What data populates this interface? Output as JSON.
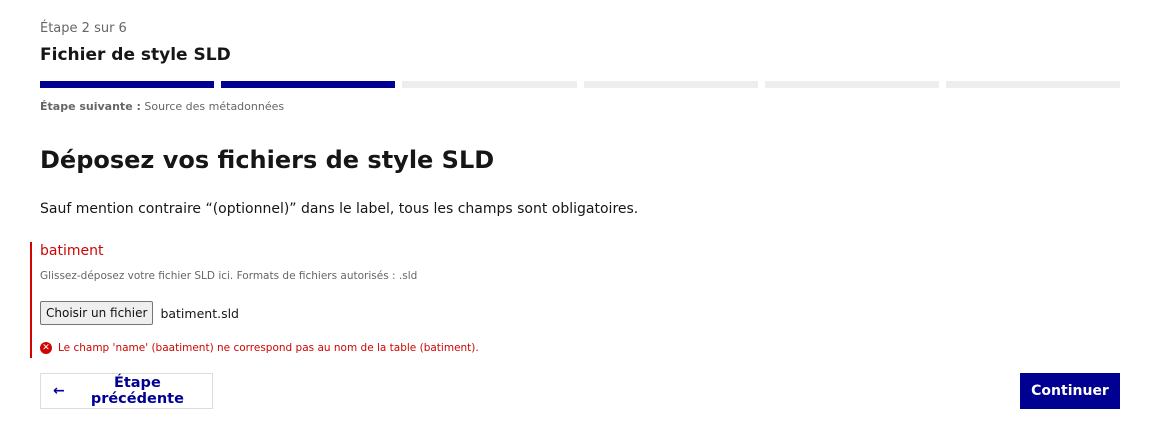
{
  "stepper": {
    "state": "Étape 2 sur 6",
    "title": "Fichier de style SLD",
    "steps_total": 6,
    "steps_done": 2,
    "next_label": "Étape suivante :",
    "next_value": "Source des métadonnées"
  },
  "main": {
    "title": "Déposez vos fichiers de style SLD",
    "intro": "Sauf mention contraire “(optionnel)” dans le label, tous les champs sont obligatoires."
  },
  "upload": {
    "label": "batiment",
    "hint": "Glissez-déposez votre fichier SLD ici. Formats de fichiers autorisés : .sld",
    "button_label": "Choisir un fichier",
    "file_name": "batiment.sld",
    "error_icon": "error-circle-icon",
    "error_message": "Le champ 'name' (baatiment) ne correspond pas au nom de la table (batiment)."
  },
  "actions": {
    "prev_icon": "arrow-left-icon",
    "prev_label": "Étape précédente",
    "next_label": "Continuer"
  },
  "colors": {
    "primary": "#000091",
    "error": "#ce0500",
    "inactive_step": "#eeeeee"
  }
}
